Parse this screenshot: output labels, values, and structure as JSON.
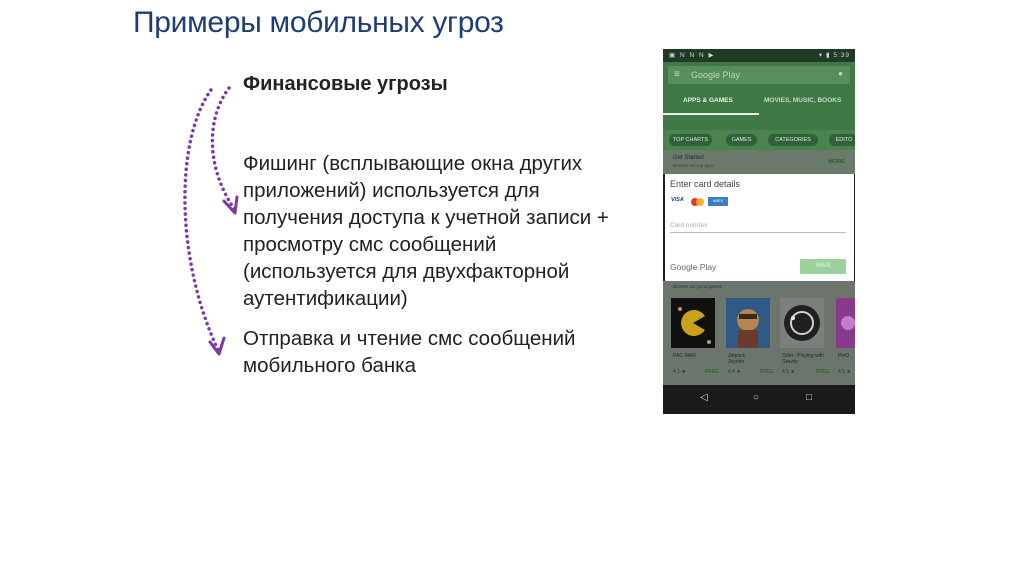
{
  "slide": {
    "title": "Примеры мобильных угроз"
  },
  "content": {
    "heading": "Финансовые угрозы",
    "paragraph1_lines": [
      "Фишинг (всплывающие окна других",
      "приложений) используется для",
      "получения доступа к учетной записи +",
      "просмотру смс сообщений",
      "(используется для двухфакторной",
      "аутентификации)"
    ],
    "paragraph2_lines": [
      "Отправка и чтение смс сообщений",
      "мобильного банка"
    ]
  },
  "colors": {
    "title": "#1f3c74",
    "arrows": "#7b3aa6",
    "play_green": "#3f7a46"
  },
  "phone": {
    "status_left": "▣ N N N ▶",
    "status_time": "5:39",
    "search_placeholder": "Google Play",
    "tabs": [
      "APPS & GAMES",
      "MOVIES, MUSIC, BOOKS"
    ],
    "chips": [
      "TOP CHARTS",
      "GAMES",
      "CATEGORIES",
      "EDITO"
    ],
    "get_started": "Get Started",
    "get_started_sub": "Browse our top apps",
    "more": "MORE",
    "dialog": {
      "title": "Enter card details",
      "visa": "VISA",
      "amex": "AMEX",
      "card_number_placeholder": "Card number",
      "google_play": "Google Play",
      "save": "SAVE"
    },
    "games_header": "Browse our go-to games",
    "games": [
      {
        "name": "PAC-MAN",
        "rating": "4.1 ★",
        "price": "FREE"
      },
      {
        "name": "Jetpack Joyride",
        "rating": "4.4 ★",
        "price": "FREE"
      },
      {
        "name": "Orbit - Playing with Gravity",
        "rating": "4.5 ★",
        "price": "FREE"
      },
      {
        "name": "PinO",
        "rating": "4.5 ★",
        "price": ""
      }
    ],
    "nav": {
      "back": "◁",
      "home": "○",
      "recents": "□"
    }
  }
}
